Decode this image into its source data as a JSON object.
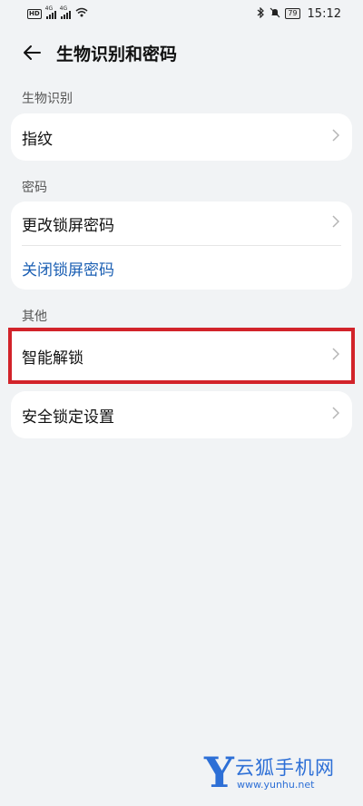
{
  "status_bar": {
    "left_badge": "HD",
    "net_label_1": "4G",
    "net_label_2": "4G",
    "battery": "79",
    "time": "15:12"
  },
  "header": {
    "title": "生物识别和密码",
    "back_icon": "arrow-left-icon"
  },
  "sections": {
    "biometrics": {
      "label": "生物识别",
      "items": [
        {
          "label": "指纹"
        }
      ]
    },
    "password": {
      "label": "密码",
      "items": [
        {
          "label": "更改锁屏密码"
        },
        {
          "label": "关闭锁屏密码"
        }
      ]
    },
    "other": {
      "label": "其他",
      "items": [
        {
          "label": "智能解锁"
        },
        {
          "label": "安全锁定设置"
        }
      ]
    }
  },
  "watermark": {
    "letter": "Y",
    "name": "云狐手机网",
    "url": "www.yunhu.net"
  },
  "colors": {
    "background": "#f1f3f5",
    "link": "#1b5fb3",
    "highlight": "#d2232a",
    "watermark": "#2d6fd6"
  }
}
